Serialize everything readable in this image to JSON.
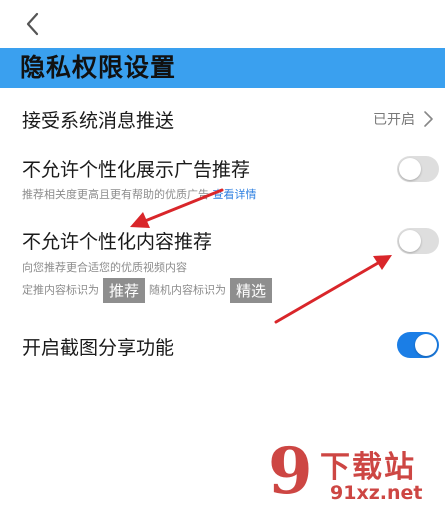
{
  "header": {
    "back_icon": "chevron-left-icon",
    "title": "隐私权限设置",
    "accent_color": "#3aa0ef"
  },
  "settings": {
    "system_push": {
      "label": "接受系统消息推送",
      "status": "已开启"
    },
    "ad_personalization": {
      "label": "不允许个性化展示广告推荐",
      "desc": "推荐相关度更高且更有帮助的优质广告",
      "link": "查看详情",
      "enabled": false
    },
    "content_personalization": {
      "label": "不允许个性化内容推荐",
      "desc": "向您推荐更合适您的优质视频内容",
      "desc2_prefix": "定推内容标识为",
      "tag1": "推荐",
      "desc2_middle": "随机内容标识为",
      "tag2": "精选",
      "enabled": false
    },
    "screenshot_share": {
      "label": "开启截图分享功能",
      "enabled": true,
      "on_color": "#1b7ee6"
    }
  },
  "annotation_color": "#d9262a",
  "watermark": {
    "logo": "9",
    "name": "下载站",
    "url": "91xz.net",
    "color": "#c8322f"
  }
}
